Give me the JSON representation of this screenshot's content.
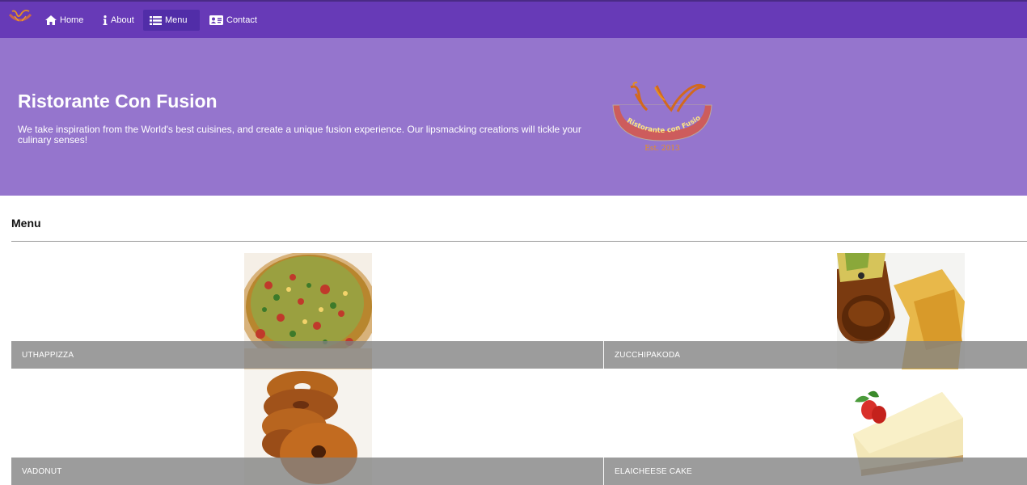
{
  "nav": {
    "items": [
      {
        "label": "Home",
        "icon": "home-icon",
        "active": false
      },
      {
        "label": "About",
        "icon": "info-icon",
        "active": false
      },
      {
        "label": "Menu",
        "icon": "list-icon",
        "active": true
      },
      {
        "label": "Contact",
        "icon": "address-card-icon",
        "active": false
      }
    ]
  },
  "jumbotron": {
    "title": "Ristorante Con Fusion",
    "text": "We take inspiration from the World's best cuisines, and create a unique fusion experience. Our lipsmacking creations will tickle your culinary senses!",
    "logo_text": "Ristorante con Fusion",
    "logo_est": "Est. 2013"
  },
  "menu": {
    "heading": "Menu",
    "dishes": [
      {
        "name": "UTHAPPIZZA"
      },
      {
        "name": "ZUCCHIPAKODA"
      },
      {
        "name": "VADONUT"
      },
      {
        "name": "ELAICHEESE CAKE"
      }
    ]
  },
  "colors": {
    "primary": "#673ab7",
    "primary_dark": "#512da8",
    "primary_light": "#9575cd",
    "caption_bar": "#808080"
  }
}
